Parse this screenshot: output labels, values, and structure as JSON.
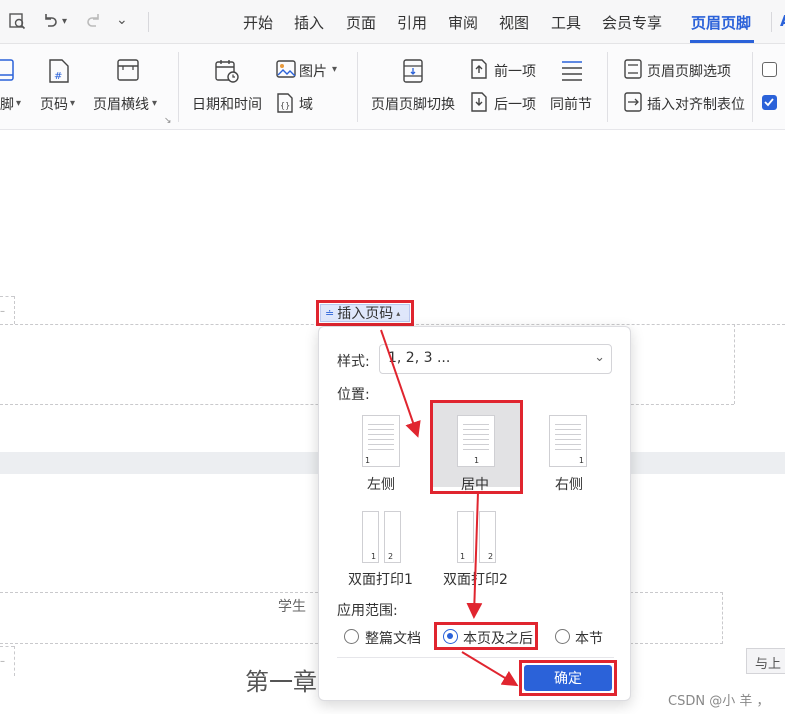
{
  "menu": {
    "tabs": [
      "开始",
      "插入",
      "页面",
      "引用",
      "审阅",
      "视图",
      "工具",
      "会员专享",
      "页眉页脚"
    ],
    "active_tab": "页眉页脚",
    "cut_tab": "A"
  },
  "ribbon": {
    "footer_label": "脚",
    "page_number_label": "页码",
    "header_line_label": "页眉横线",
    "datetime_label": "日期和时间",
    "picture_label": "图片",
    "field_label": "域",
    "switch_label": "页眉页脚切换",
    "prev_label": "前一项",
    "next_label": "后一项",
    "same_as_prev_label": "同前节",
    "options_label": "页眉页脚选项",
    "insert_align_tab_label": "插入对齐制表位",
    "checkbox1_checked": false,
    "checkbox2_checked": true
  },
  "doc": {
    "chip_label": "插入页码",
    "student_text": "学生",
    "chapter_text": "第一章",
    "right_badge": "与上"
  },
  "popup": {
    "style_label": "样式:",
    "style_value": "1, 2, 3 ...",
    "position_label": "位置:",
    "positions": [
      {
        "label": "左侧",
        "num": "1"
      },
      {
        "label": "居中",
        "num": "1"
      },
      {
        "label": "右侧",
        "num": "1"
      },
      {
        "label": "双面打印1",
        "nums": [
          "1",
          "2"
        ]
      },
      {
        "label": "双面打印2",
        "nums": [
          "1",
          "2"
        ]
      }
    ],
    "selected_position": "居中",
    "scope_label": "应用范围:",
    "scope_options": [
      "整篇文档",
      "本页及之后",
      "本节"
    ],
    "selected_scope": "本页及之后",
    "ok_label": "确定"
  },
  "watermark": "CSDN @小 羊 ，",
  "colors": {
    "accent": "#2b62d9",
    "highlight_red": "#e0252f"
  }
}
